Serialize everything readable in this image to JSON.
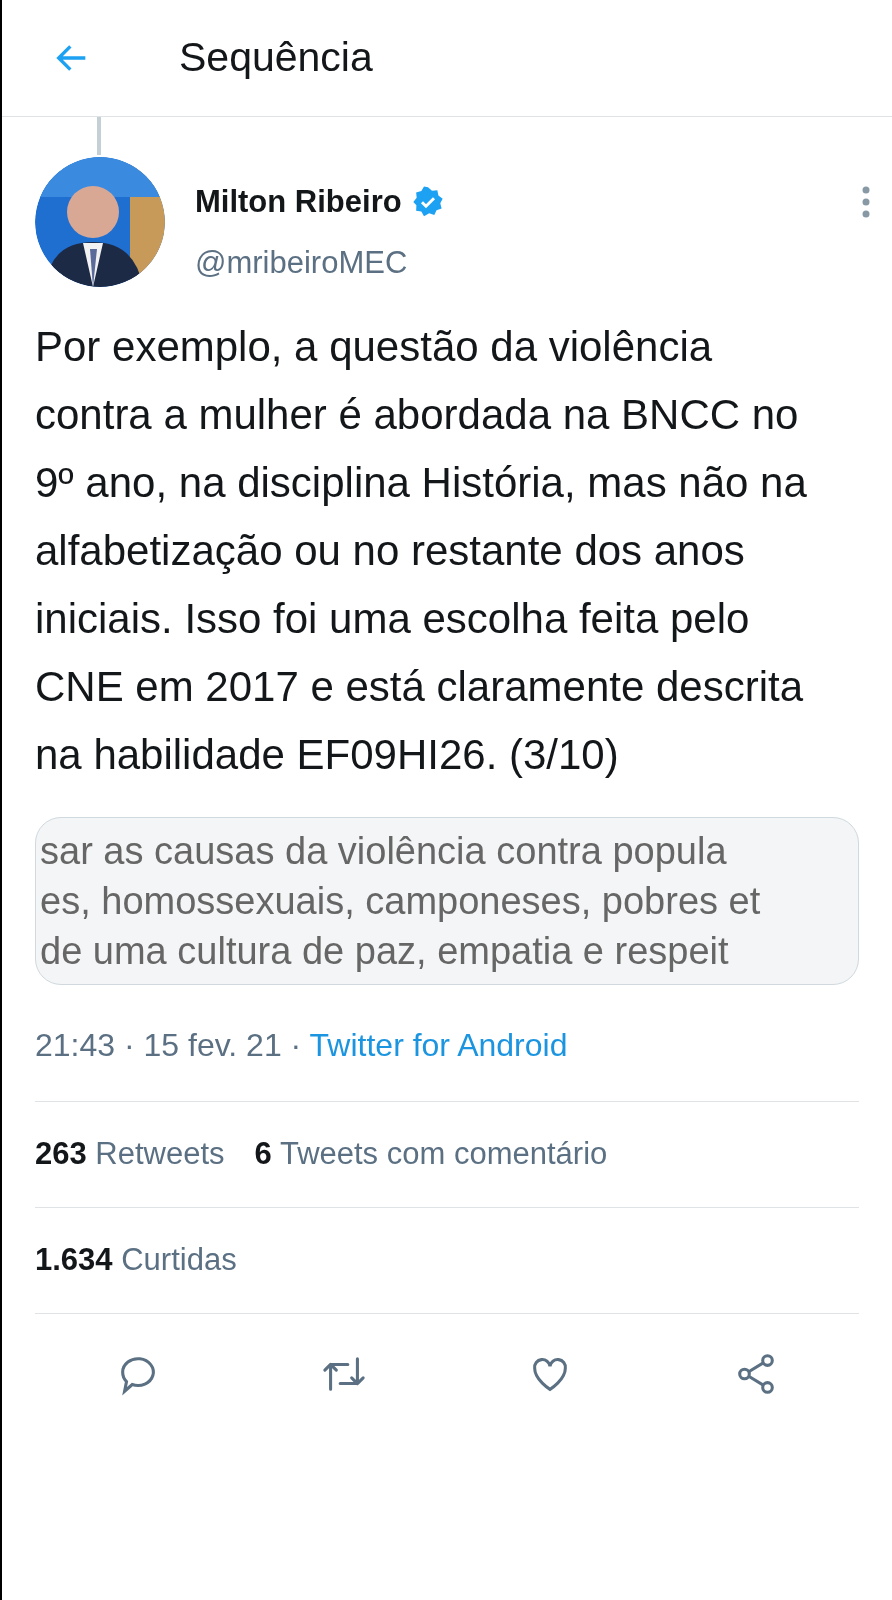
{
  "header": {
    "title": "Sequência"
  },
  "tweet": {
    "name": "Milton Ribeiro",
    "verified": true,
    "handle": "@mribeiroMEC",
    "text": "Por exemplo, a questão da violência contra a mulher é abordada na BNCC no 9º ano, na disciplina História, mas não na alfabetização ou no restante dos anos iniciais. Isso foi uma escolha feita pelo CNE em 2017 e está claramente descrita na habilidade EF09HI26. (3/10)",
    "attachment_lines": [
      "sar as causas da violência contra popula",
      "es, homossexuais, camponeses, pobres et",
      "de uma cultura de paz, empatia e respeit"
    ],
    "time": "21:43 · 15 fev. 21 · ",
    "source": "Twitter for Android",
    "stats_rows": [
      [
        {
          "count": "263",
          "label": "Retweets"
        },
        {
          "count": "6",
          "label": "Tweets com comentário"
        }
      ],
      [
        {
          "count": "1.634",
          "label": "Curtidas"
        }
      ]
    ],
    "actions": [
      {
        "kind": "reply"
      },
      {
        "kind": "retweet"
      },
      {
        "kind": "like"
      },
      {
        "kind": "share"
      }
    ]
  }
}
